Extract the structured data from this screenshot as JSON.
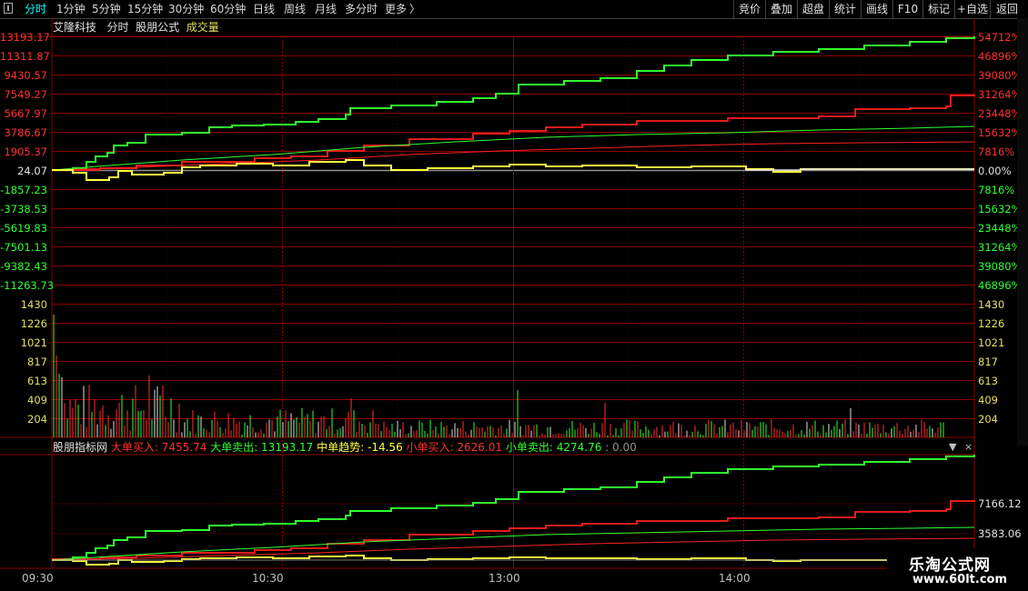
{
  "toolbar": {
    "tabs": [
      "分时",
      "1分钟",
      "5分钟",
      "15分钟",
      "30分钟",
      "60分钟",
      "日线",
      "周线",
      "月线",
      "多分时",
      "更多"
    ],
    "more_arrow": "〉",
    "right_buttons": [
      "竞价",
      "叠加",
      "超盘",
      "统计",
      "画线",
      "F10",
      "标记",
      "+自选",
      "返回"
    ]
  },
  "header": {
    "stock": "艾隆科技",
    "mode": "分时",
    "formula": "股朋公式",
    "volume": "成交量"
  },
  "price_axis_left": [
    "13193.17",
    "11311.87",
    "9430.57",
    "7549.27",
    "5667.97",
    "3786.67",
    "1905.37",
    "24.07",
    "-1857.23",
    "-3738.53",
    "-5619.83",
    "-7501.13",
    "-9382.43",
    "-11263.73"
  ],
  "price_axis_right": [
    "54712%",
    "46896%",
    "39080%",
    "31264%",
    "23448%",
    "15632%",
    "7816%",
    "0.00%",
    "7816%",
    "15632%",
    "23448%",
    "31264%",
    "39080%",
    "46896%"
  ],
  "volume_axis": [
    "1430",
    "1226",
    "1021",
    "817",
    "613",
    "409",
    "204"
  ],
  "indicator": {
    "name": "股朋指标网",
    "items": [
      {
        "label": "大单买入",
        "value": "7455.74",
        "color": "#ff3030"
      },
      {
        "label": "大单卖出",
        "value": "13193.17",
        "color": "#30ff30"
      },
      {
        "label": "中单趋势",
        "value": "-14.56",
        "color": "#ffff40"
      },
      {
        "label": "小单买入",
        "value": "2626.01",
        "color": "#ff3030"
      },
      {
        "label": "小单卖出",
        "value": "4274.76",
        "color": "#30ff30"
      }
    ],
    "extra": ": 0.00",
    "axis": [
      "7166.12",
      "3583.06"
    ]
  },
  "time_axis": [
    "09:30",
    "10:30",
    "13:00",
    "14:00"
  ],
  "watermark": {
    "line1": "乐淘公式网",
    "line2": "www.60lt.com"
  },
  "colors": {
    "grid": "#8b0000",
    "green": "#30ff30",
    "red": "#ff2020",
    "yellow": "#ffff40",
    "white": "#e0e0e0"
  }
}
